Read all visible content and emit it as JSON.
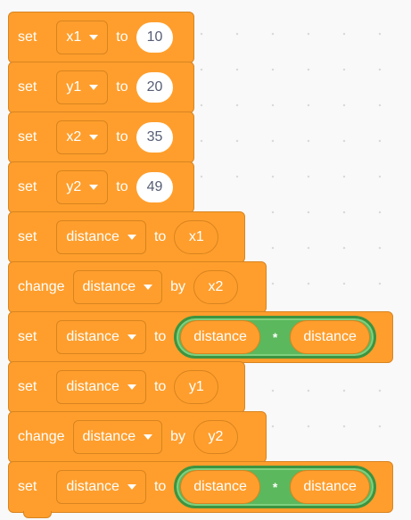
{
  "blocks": [
    {
      "kind": "set",
      "verb": "set",
      "var": "x1",
      "prep": "to",
      "value": "10",
      "value_type": "number",
      "width": 209
    },
    {
      "kind": "set",
      "verb": "set",
      "var": "y1",
      "prep": "to",
      "value": "20",
      "value_type": "number",
      "width": 209
    },
    {
      "kind": "set",
      "verb": "set",
      "var": "x2",
      "prep": "to",
      "value": "35",
      "value_type": "number",
      "width": 209
    },
    {
      "kind": "set",
      "verb": "set",
      "var": "y2",
      "prep": "to",
      "value": "49",
      "value_type": "number",
      "width": 209
    },
    {
      "kind": "set",
      "verb": "set",
      "var": "distance",
      "prep": "to",
      "value": "x1",
      "value_type": "variable",
      "width": 266
    },
    {
      "kind": "change",
      "verb": "change",
      "var": "distance",
      "prep": "by",
      "value": "x2",
      "value_type": "variable",
      "width": 290
    },
    {
      "kind": "set-mult",
      "verb": "set",
      "var": "distance",
      "prep": "to",
      "left": "distance",
      "op": "*",
      "right": "distance",
      "width": 432
    },
    {
      "kind": "set",
      "verb": "set",
      "var": "distance",
      "prep": "to",
      "value": "y1",
      "value_type": "variable",
      "width": 266
    },
    {
      "kind": "change",
      "verb": "change",
      "var": "distance",
      "prep": "by",
      "value": "y2",
      "value_type": "variable",
      "width": 290
    },
    {
      "kind": "set-mult",
      "verb": "set",
      "var": "distance",
      "prep": "to",
      "left": "distance",
      "op": "*",
      "right": "distance",
      "width": 432
    }
  ]
}
